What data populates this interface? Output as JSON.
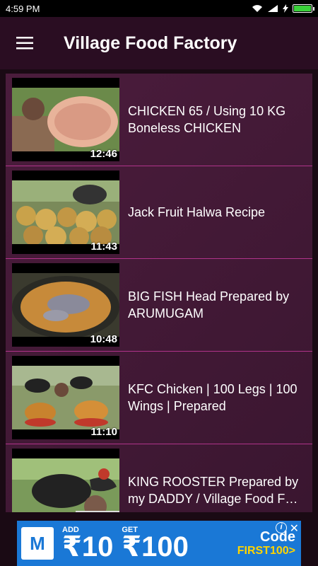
{
  "status_bar": {
    "time": "4:59 PM",
    "battery_level": 1.0,
    "icons": [
      "wifi-icon",
      "signal-icon",
      "charging-icon",
      "battery-icon"
    ]
  },
  "app_bar": {
    "menu_icon": "hamburger-icon",
    "title": "Village Food Factory"
  },
  "videos": [
    {
      "title": "CHICKEN 65 / Using 10 KG Boneless CHICKEN",
      "duration": "12:46"
    },
    {
      "title": "Jack Fruit Halwa Recipe",
      "duration": "11:43"
    },
    {
      "title": "BIG FISH Head Prepared by ARUMUGAM",
      "duration": "10:48"
    },
    {
      "title": "KFC Chicken | 100 Legs | 100 Wings | Prepared",
      "duration": "11:10"
    },
    {
      "title": "KING ROOSTER Prepared by my DADDY / Village Food F…",
      "duration": ""
    }
  ],
  "ad": {
    "logo": "M",
    "add_label": "ADD",
    "add_amount": "₹10",
    "get_label": "GET",
    "get_amount": "₹100",
    "code_label": "Code",
    "code_value": "FIRST100>",
    "info_icon": "info-icon",
    "close_icon": "close-icon",
    "accent": "#1a78d6"
  },
  "colors": {
    "app_bar": "#2a0d22",
    "list_bg": "#4b1c3c",
    "divider": "#b0338a"
  }
}
